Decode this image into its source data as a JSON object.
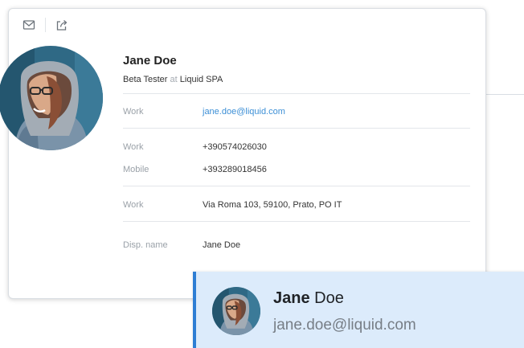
{
  "toolbar": {
    "email_icon": "envelope-icon",
    "share_icon": "share-icon"
  },
  "contact": {
    "first_name": "Jane",
    "last_name": "Doe",
    "full_name": "Jane Doe",
    "role": "Beta Tester",
    "at": "at",
    "company": "Liquid SPA"
  },
  "details": {
    "email": {
      "label": "Work",
      "value": "jane.doe@liquid.com"
    },
    "phone_work": {
      "label": "Work",
      "value": "+390574026030"
    },
    "phone_mobile": {
      "label": "Mobile",
      "value": "+393289018456"
    },
    "address": {
      "label": "Work",
      "value": "Via Roma 103, 59100, Prato, PO IT"
    },
    "display_name": {
      "label": "Disp. name",
      "value": "Jane Doe"
    }
  },
  "hover_card": {
    "first_name": "Jane",
    "last_name": "Doe",
    "email": "jane.doe@liquid.com"
  },
  "colors": {
    "link": "#3c8fd6",
    "accent": "#2e7ed4",
    "hover_bg": "#dcebfb"
  }
}
